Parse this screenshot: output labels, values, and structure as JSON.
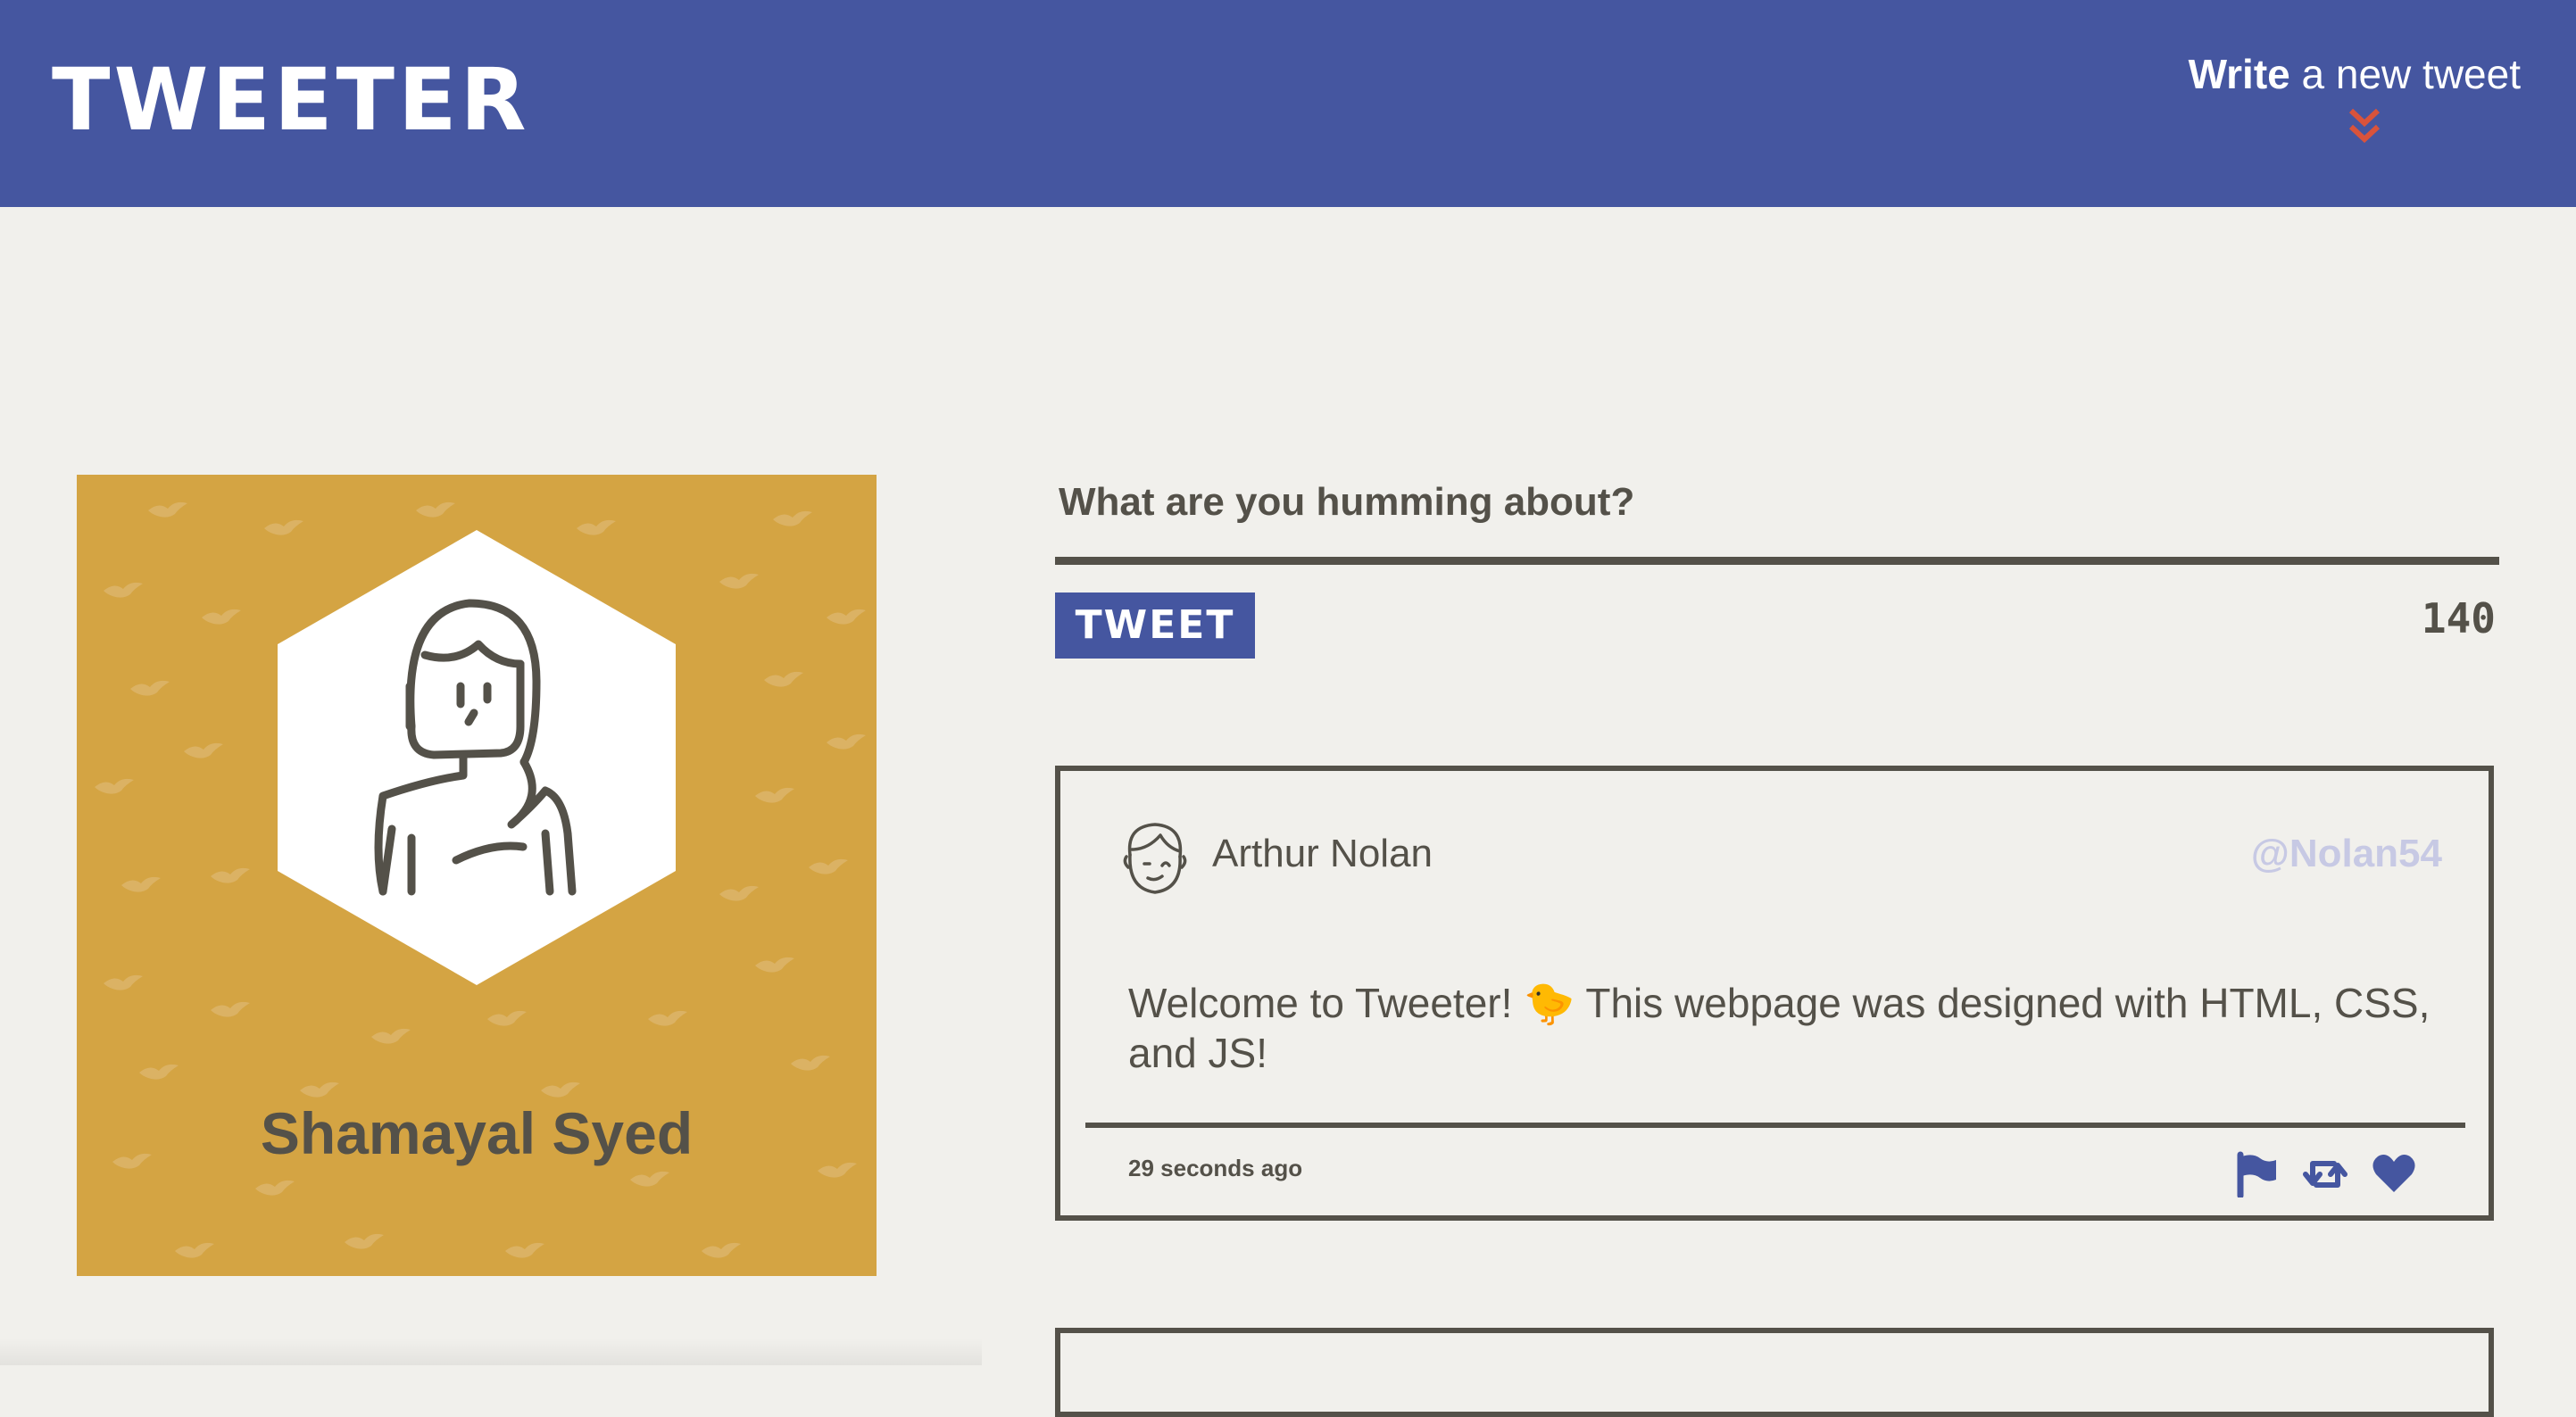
{
  "nav": {
    "logo": "TWEETER",
    "write_bold": "Write",
    "write_rest": " a new tweet"
  },
  "profile": {
    "name": "Shamayal Syed"
  },
  "compose": {
    "label": "What are you humming about?",
    "placeholder": "",
    "button": "TWEET",
    "counter": "140"
  },
  "tweets": [
    {
      "name": "Arthur Nolan",
      "handle": "@Nolan54",
      "text": "Welcome to Tweeter! 🐤 This webpage was designed with HTML, CSS, and JS!",
      "time": "29 seconds ago"
    }
  ],
  "icons": {
    "write_toggle": "double-chevron-down-icon",
    "flag": "flag-icon",
    "retweet": "retweet-icon",
    "like": "heart-icon"
  },
  "colors": {
    "nav": "#4556a0",
    "accent_red": "#d9533b",
    "profile_bg": "#d4a443",
    "page_bg": "#f1f0ec",
    "text": "#545149",
    "handle": "#c7c9e4"
  }
}
